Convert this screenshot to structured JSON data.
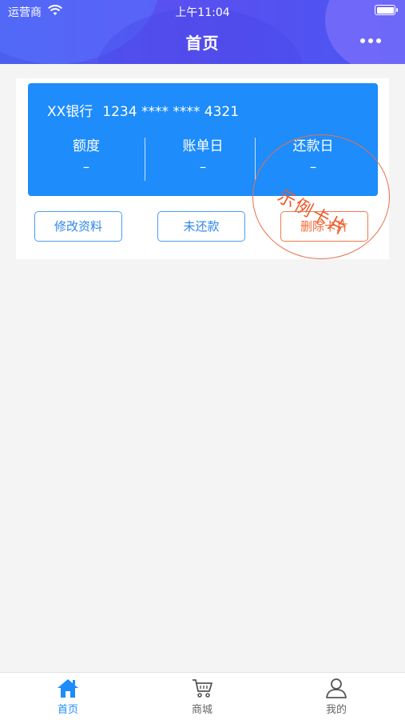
{
  "status_bar": {
    "carrier": "运营商",
    "time": "上午11:04"
  },
  "header": {
    "title": "首页"
  },
  "card": {
    "bank": "XX银行",
    "number": "1234 **** **** 4321",
    "stats": [
      {
        "label": "额度",
        "value": "–"
      },
      {
        "label": "账单日",
        "value": "–"
      },
      {
        "label": "还款日",
        "value": "–"
      }
    ],
    "stamp": "示例卡片"
  },
  "actions": {
    "edit": "修改资料",
    "unpaid": "未还款",
    "delete": "删除卡片"
  },
  "tabbar": {
    "items": [
      {
        "label": "首页",
        "icon": "home-icon",
        "active": true
      },
      {
        "label": "商城",
        "icon": "cart-icon",
        "active": false
      },
      {
        "label": "我的",
        "icon": "user-icon",
        "active": false
      }
    ]
  },
  "colors": {
    "accent": "#1e8cfa",
    "danger": "#ef6a36",
    "header": "#4b5ef0"
  }
}
